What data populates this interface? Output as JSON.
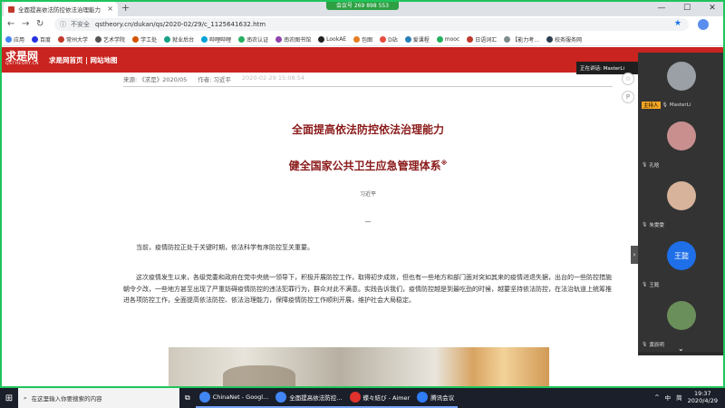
{
  "browser": {
    "tab_title": "全面提高依法防控依法治理能力",
    "meeting_pill": "会议号 269 898 553",
    "url": "qstheory.cn/dukan/qs/2020-02/29/c_1125641632.htm",
    "security_label": "不安全"
  },
  "bookmarks": [
    {
      "label": "应用",
      "color": "#4285f4"
    },
    {
      "label": "百度",
      "color": "#2932e1"
    },
    {
      "label": "常州大学",
      "color": "#c0392b"
    },
    {
      "label": "艺术学院",
      "color": "#555"
    },
    {
      "label": "学工处",
      "color": "#d35400"
    },
    {
      "label": "就业后台",
      "color": "#16a085"
    },
    {
      "label": "哔哩哔哩",
      "color": "#00a1d6"
    },
    {
      "label": "南农认证",
      "color": "#27ae60"
    },
    {
      "label": "南农图书馆",
      "color": "#8e44ad"
    },
    {
      "label": "LookAE",
      "color": "#222"
    },
    {
      "label": "包图",
      "color": "#e67e22"
    },
    {
      "label": "D站",
      "color": "#e74c3c"
    },
    {
      "label": "爱课程",
      "color": "#2980b9"
    },
    {
      "label": "mooc",
      "color": "#27ae60"
    },
    {
      "label": "日语词汇",
      "color": "#c0392b"
    },
    {
      "label": "【能力考...",
      "color": "#7f8c8d"
    },
    {
      "label": "校务服务网",
      "color": "#2c3e50"
    }
  ],
  "site": {
    "logo_cn": "求是网",
    "logo_en": "QSTHEORY.CN",
    "nav": "求是网首页 | 网站地图"
  },
  "speaking": "正在讲话: MasterLi",
  "article": {
    "source": "来源: 《求是》2020/05",
    "author_meta": "作者: 习近平",
    "date": "2020-02-29 15:08:54",
    "title1": "全面提高依法防控依法治理能力",
    "title2": "健全国家公共卫生应急管理体系",
    "title2_mark": "※",
    "author": "习近平",
    "section": "一",
    "p1": "当前，疫情防控正处于关键时期，依法科学有序防控至关重要。",
    "p2": "这次疫情发生以来，各级党委和政府在党中央统一领导下，积极开展防控工作，取得初步成效，但也有一些地方和部门面对突如其来的疫情进退失据，出台的一些防控措施朝令夕改，一些地方甚至出现了严重妨碍疫情防控的违法犯罪行为，群众对此不满意。实践告诉我们，疫情防控越是到最吃劲的时候，越要坚持依法防控，在法治轨道上统筹推进各项防控工作，全面提高依法防控、依法治理能力，保障疫情防控工作顺利开展，维护社会大局稳定。"
  },
  "participants": [
    {
      "name": "MasterLi",
      "host": "主持人",
      "color": "#9aa0a6"
    },
    {
      "name": "孔晗",
      "host": "",
      "color": "#c98f8f"
    },
    {
      "name": "朱雯雯",
      "host": "",
      "color": "#d6b39a"
    },
    {
      "name": "王懿",
      "host": "",
      "initials": "王懿",
      "color": "#1e6fe8"
    },
    {
      "name": "黄辰明",
      "host": "",
      "color": "#6b8f5a"
    }
  ],
  "taskbar": {
    "search_placeholder": "在这里输入你要搜索的内容",
    "items": [
      {
        "label": "ChinaNet - Googl...",
        "color": "#4285f4"
      },
      {
        "label": "全面提高依法防控...",
        "color": "#4285f4"
      },
      {
        "label": "蝶々結び - Aimer",
        "color": "#e0312c"
      },
      {
        "label": "腾讯会议",
        "color": "#2e7cf6"
      }
    ],
    "ime": "中",
    "ime2": "简",
    "time": "19:37",
    "date": "2020/4/29"
  }
}
